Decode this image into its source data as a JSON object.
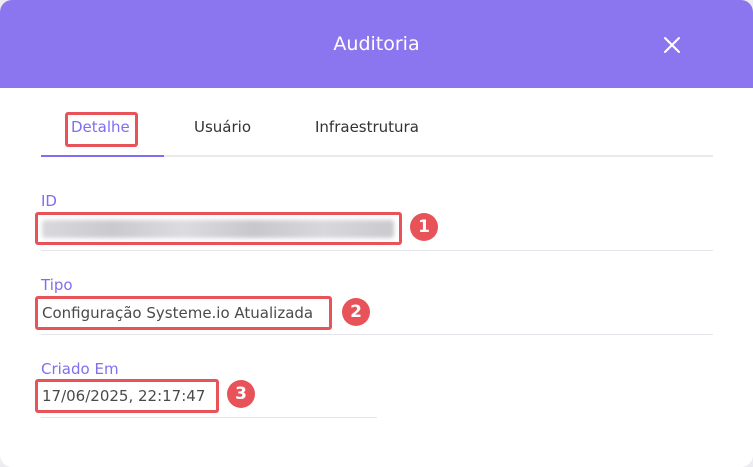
{
  "dialog": {
    "title": "Auditoria",
    "header_color": "#8b76f0",
    "accent_color": "#7f6ef0",
    "highlight_color": "#e8535a"
  },
  "tabs": [
    {
      "label": "Detalhe",
      "active": true
    },
    {
      "label": "Usuário",
      "active": false
    },
    {
      "label": "Infraestrutura",
      "active": false
    }
  ],
  "fields": {
    "id": {
      "label": "ID",
      "value_blurred": true
    },
    "tipo": {
      "label": "Tipo",
      "value": "Configuração Systeme.io Atualizada"
    },
    "criado_em": {
      "label": "Criado Em",
      "value": "17/06/2025, 22:17:47"
    }
  },
  "annotations": [
    "1",
    "2",
    "3"
  ],
  "icons": {
    "close": "close-icon"
  }
}
